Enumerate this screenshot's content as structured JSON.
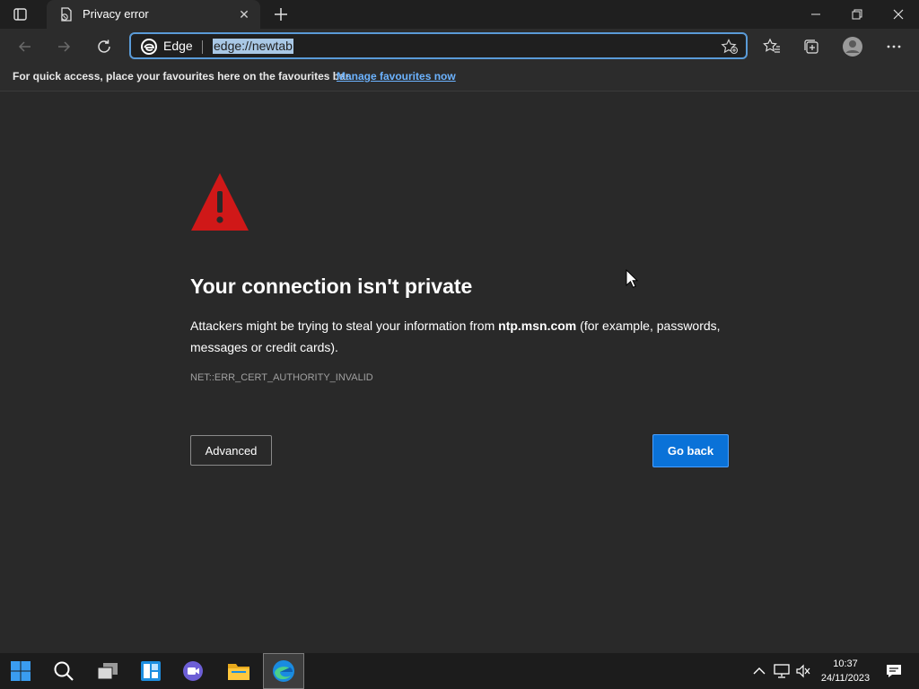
{
  "tab": {
    "title": "Privacy error"
  },
  "address_bar": {
    "brand": "Edge",
    "url": "edge://newtab"
  },
  "favourites_bar": {
    "message": "For quick access, place your favourites here on the favourites bar.",
    "link": "Manage favourites now"
  },
  "error_page": {
    "heading": "Your connection isn't private",
    "description_before": "Attackers might be trying to steal your information from ",
    "domain": "ntp.msn.com",
    "description_after": " (for example, passwords, messages or credit cards).",
    "error_code": "NET::ERR_CERT_AUTHORITY_INVALID",
    "advanced_label": "Advanced",
    "go_back_label": "Go back"
  },
  "taskbar": {
    "time": "10:37",
    "date": "24/11/2023",
    "apps": [
      "start-icon",
      "search-icon",
      "task-view-icon",
      "widgets-icon",
      "chat-icon",
      "file-explorer-icon",
      "edge-icon"
    ]
  },
  "colors": {
    "accent": "#0a72d8",
    "warning": "#d01818",
    "background": "#292929",
    "link": "#6cb3ff"
  }
}
